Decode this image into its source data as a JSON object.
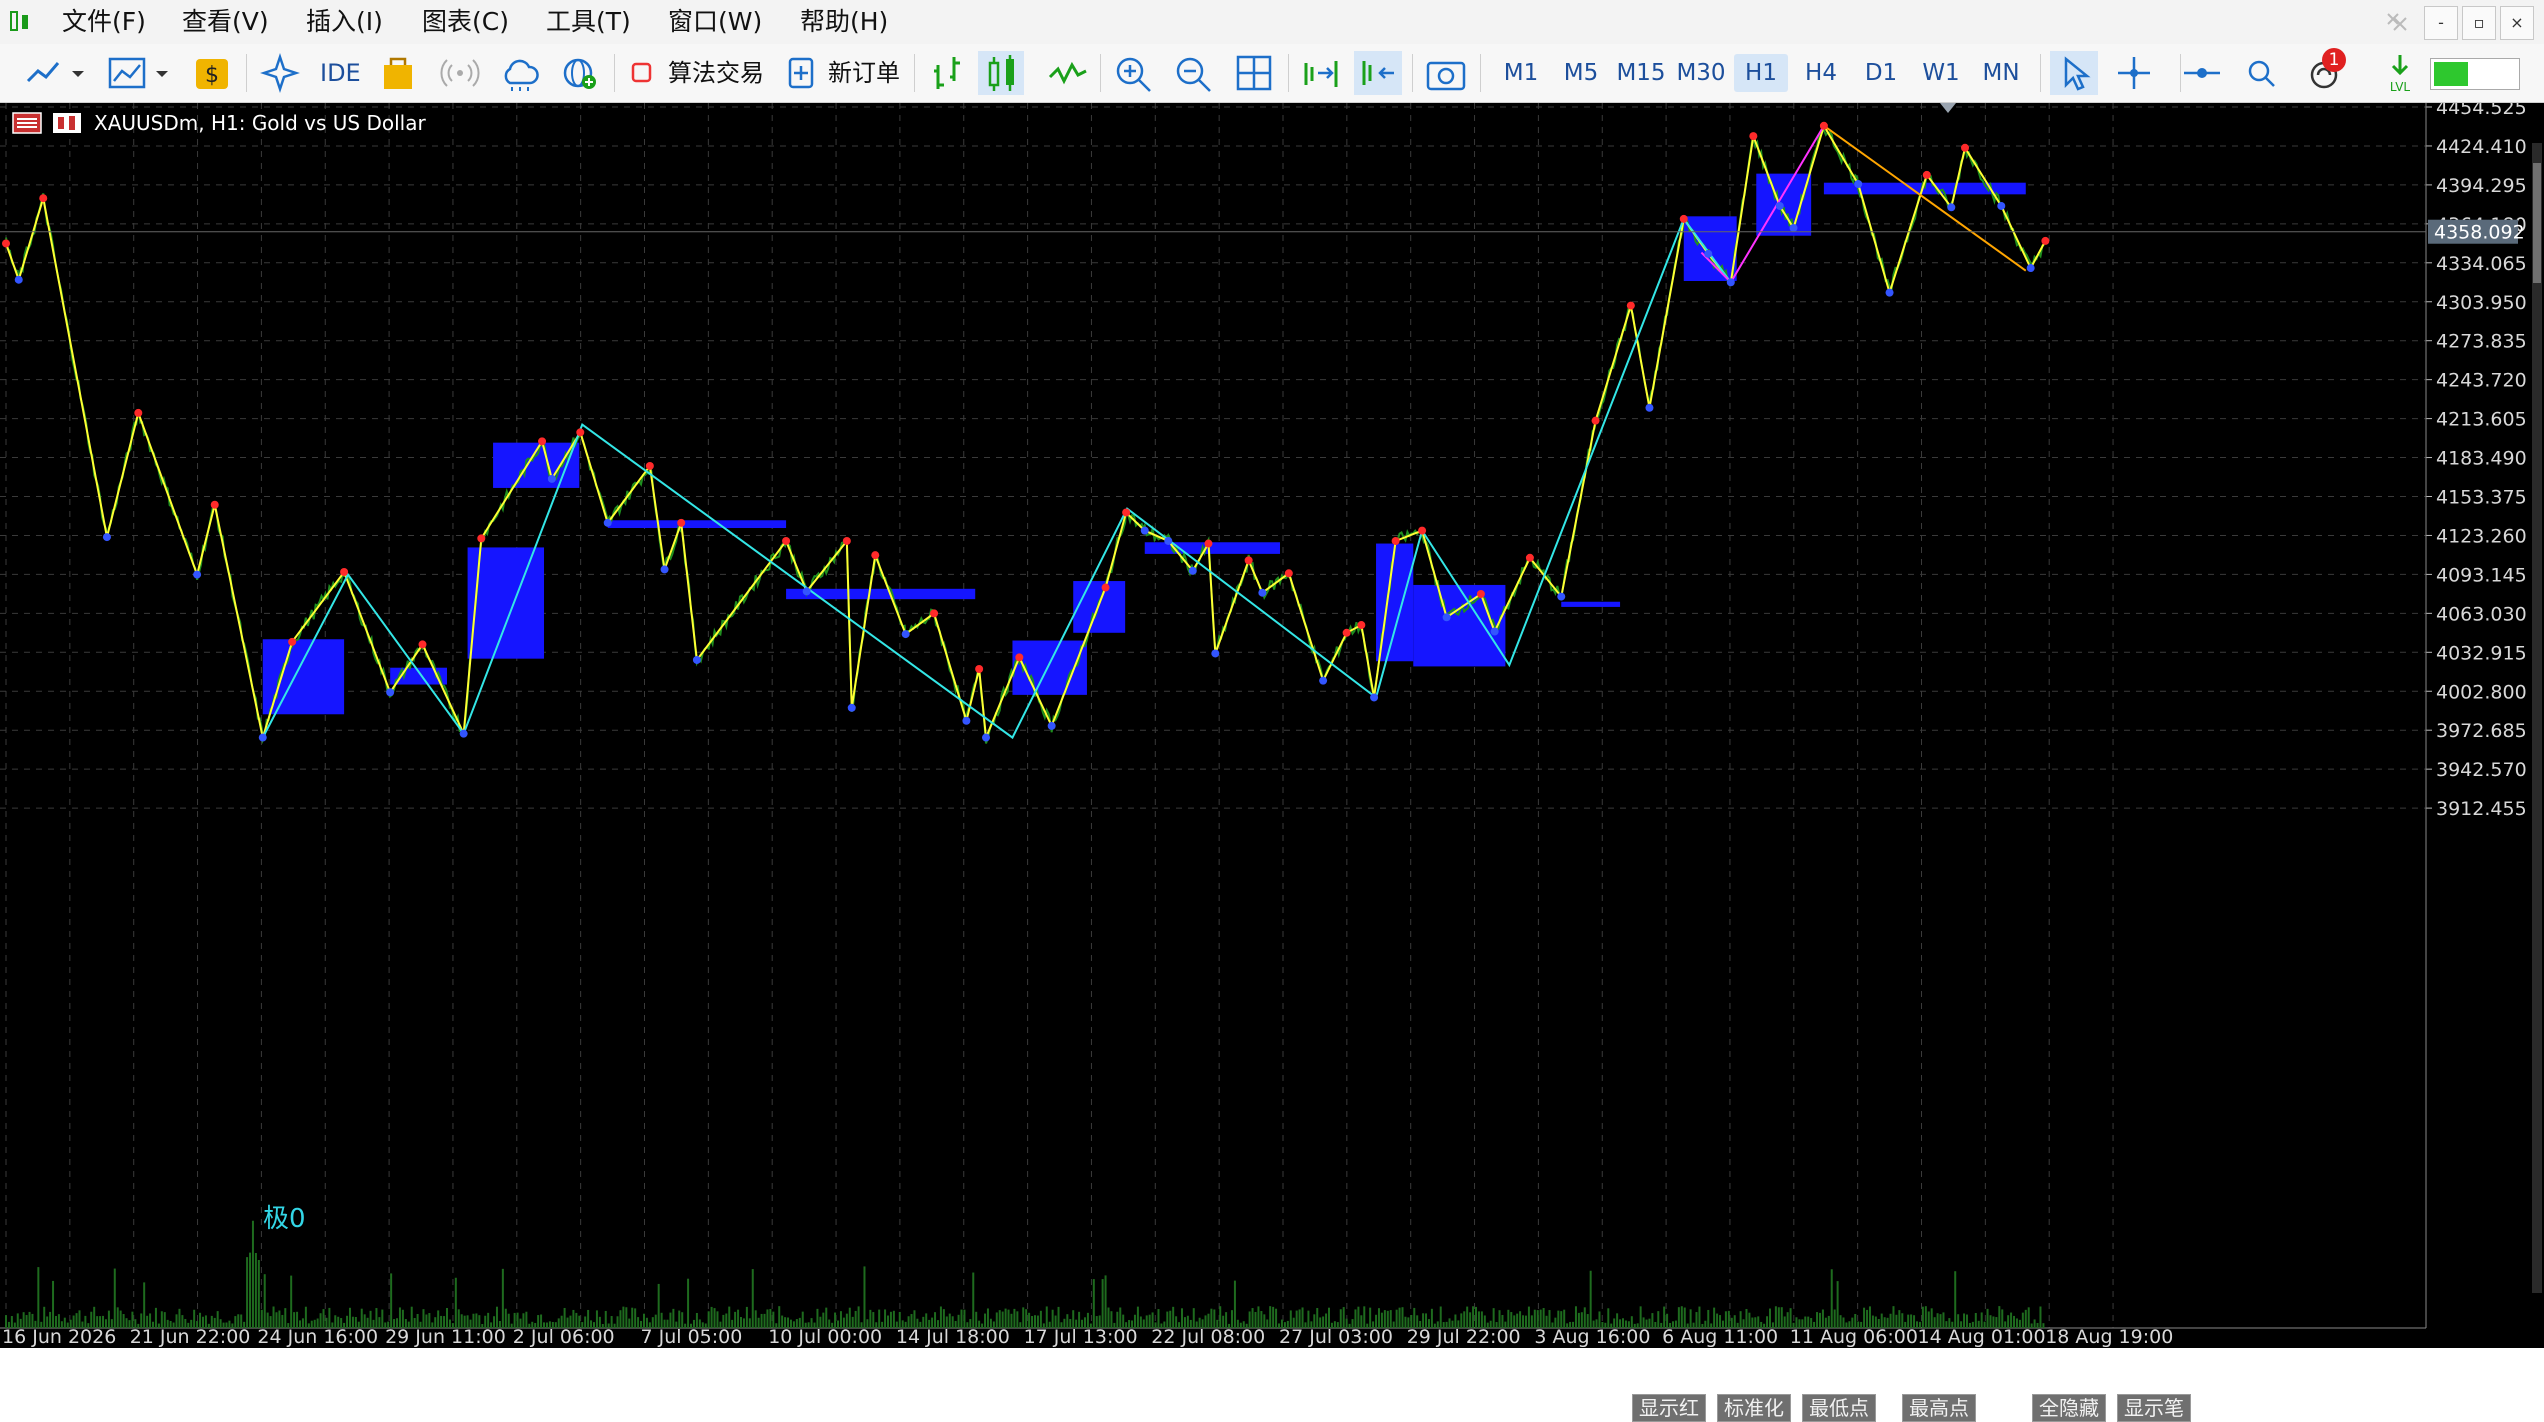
{
  "menu": {
    "items": [
      "文件(F)",
      "查看(V)",
      "插入(I)",
      "图表(C)",
      "工具(T)",
      "窗口(W)",
      "帮助(H)"
    ]
  },
  "window_controls": {
    "minimize": "-",
    "restore": "▫",
    "close": "×"
  },
  "toolbar": {
    "ide_label": "IDE",
    "algo_trading_label": "算法交易",
    "new_order_label": "新订单",
    "timeframes": [
      "M1",
      "M5",
      "M15",
      "M30",
      "H1",
      "H4",
      "D1",
      "W1",
      "MN"
    ],
    "active_timeframe": "H1",
    "notification_count": "1",
    "icons": [
      "line-tool-icon",
      "chart-type-icon",
      "dollar-icon",
      "sparkle-icon",
      "shopping-bag-icon",
      "signal-icon",
      "cloud-icon",
      "globe-add-icon",
      "bar-chart-icon",
      "candlestick-icon",
      "line-chart-icon",
      "zoom-in-icon",
      "zoom-out-icon",
      "grid-icon",
      "autoscroll-icon",
      "chart-shift-icon",
      "screenshot-icon",
      "cursor-icon",
      "crosshair-icon",
      "horizontal-line-icon",
      "search-icon",
      "notifications-icon",
      "lvl-icon",
      "signal-strength-icon"
    ]
  },
  "chart": {
    "header": "XAUUSDm, H1:  Gold vs US Dollar",
    "current_price": "4358.092",
    "pivot_label": "极0",
    "colors": {
      "background": "#000000",
      "grid": "#3a3a3a",
      "price_series": "#1f8f1f",
      "zigzag": "#ffff33",
      "swing_line": "#33e6e6",
      "pink_line": "#ff33ff",
      "orange_line": "#ffa500",
      "zone": "#1515ff",
      "pivot_marker": "#ff2a2a"
    },
    "price_axis": [
      "4454.525",
      "4424.410",
      "4394.295",
      "4364.180",
      "4334.065",
      "4303.950",
      "4273.835",
      "4243.720",
      "4213.605",
      "4183.490",
      "4153.375",
      "4123.260",
      "4093.145",
      "4063.030",
      "4032.915",
      "4002.800",
      "3972.685",
      "3942.570",
      "3912.455"
    ],
    "time_axis": [
      "16 Jun 2026",
      "21 Jun 22:00",
      "24 Jun 16:00",
      "29 Jun 11:00",
      "2 Jul 06:00",
      "7 Jul 05:00",
      "10 Jul 00:00",
      "14 Jul 18:00",
      "17 Jul 13:00",
      "22 Jul 08:00",
      "27 Jul 03:00",
      "29 Jul 22:00",
      "3 Aug 16:00",
      "6 Aug 11:00",
      "11 Aug 06:00",
      "14 Aug 01:00",
      "18 Aug 19:00"
    ],
    "bottom_buttons": [
      "显示红",
      "标准化",
      "最低点",
      "最高点",
      "全隐藏",
      "显示笔"
    ]
  },
  "chart_data": {
    "type": "line",
    "symbol": "XAUUSDm",
    "timeframe": "H1",
    "title": "Gold vs US Dollar",
    "ylim": [
      3897,
      4462
    ],
    "x": [
      "16 Jun 2026",
      "21 Jun 22:00",
      "24 Jun 16:00",
      "29 Jun 11:00",
      "2 Jul 06:00",
      "7 Jul 05:00",
      "10 Jul 00:00",
      "14 Jul 18:00",
      "17 Jul 13:00",
      "22 Jul 08:00",
      "27 Jul 03:00",
      "29 Jul 22:00",
      "3 Aug 16:00",
      "6 Aug 11:00",
      "11 Aug 06:00",
      "14 Aug 01:00",
      "18 Aug 19:00"
    ],
    "series": [
      {
        "type": "zigzag",
        "points": [
          [
            0,
            4349
          ],
          [
            13,
            4321
          ],
          [
            38,
            4384
          ],
          [
            103,
            4122
          ],
          [
            135,
            4218
          ],
          [
            195,
            4093
          ],
          [
            213,
            4147
          ],
          [
            262,
            3967
          ],
          [
            292,
            4041
          ],
          [
            345,
            4095
          ],
          [
            392,
            4002
          ],
          [
            425,
            4039
          ],
          [
            467,
            3970
          ],
          [
            485,
            4121
          ],
          [
            547,
            4196
          ],
          [
            557,
            4167
          ],
          [
            586,
            4203
          ],
          [
            614,
            4133
          ],
          [
            657,
            4177
          ],
          [
            672,
            4097
          ],
          [
            689,
            4133
          ],
          [
            705,
            4027
          ],
          [
            796,
            4119
          ],
          [
            817,
            4080
          ],
          [
            858,
            4119
          ],
          [
            863,
            3990
          ],
          [
            887,
            4108
          ],
          [
            918,
            4047
          ],
          [
            947,
            4063
          ],
          [
            980,
            3980
          ],
          [
            993,
            4020
          ],
          [
            1000,
            3967
          ],
          [
            1034,
            4029
          ],
          [
            1067,
            3976
          ],
          [
            1122,
            4083
          ],
          [
            1143,
            4141
          ],
          [
            1162,
            4127
          ],
          [
            1186,
            4119
          ],
          [
            1211,
            4096
          ],
          [
            1227,
            4117
          ],
          [
            1234,
            4032
          ],
          [
            1268,
            4104
          ],
          [
            1282,
            4079
          ],
          [
            1309,
            4094
          ],
          [
            1344,
            4011
          ],
          [
            1368,
            4048
          ],
          [
            1383,
            4054
          ],
          [
            1396,
            3998
          ],
          [
            1418,
            4119
          ],
          [
            1445,
            4127
          ],
          [
            1470,
            4060
          ],
          [
            1505,
            4078
          ],
          [
            1519,
            4049
          ],
          [
            1555,
            4106
          ],
          [
            1587,
            4076
          ],
          [
            1622,
            4212
          ],
          [
            1658,
            4301
          ],
          [
            1677,
            4222
          ],
          [
            1712,
            4368
          ],
          [
            1737,
            4341
          ],
          [
            1760,
            4319
          ],
          [
            1783,
            4432
          ],
          [
            1810,
            4378
          ],
          [
            1824,
            4361
          ],
          [
            1855,
            4440
          ],
          [
            1890,
            4395
          ],
          [
            1922,
            4311
          ],
          [
            1960,
            4402
          ],
          [
            1985,
            4377
          ],
          [
            1999,
            4423
          ],
          [
            2036,
            4378
          ],
          [
            2066,
            4330
          ],
          [
            2081,
            4351
          ]
        ]
      },
      {
        "type": "swing",
        "points": [
          [
            262,
            3967
          ],
          [
            349,
            4093
          ],
          [
            467,
            3970
          ],
          [
            588,
            4209
          ],
          [
            1027,
            3967
          ],
          [
            1144,
            4144
          ],
          [
            1398,
            3998
          ],
          [
            1445,
            4127
          ],
          [
            1534,
            4023
          ],
          [
            1712,
            4368
          ],
          [
            1760,
            4319
          ]
        ]
      },
      {
        "type": "overlay",
        "points": [
          [
            1730,
            4342
          ],
          [
            1760,
            4319
          ],
          [
            1855,
            4440
          ],
          [
            2061,
            4328
          ]
        ]
      }
    ],
    "zones": [
      {
        "from": "24 Jun",
        "top": 4043,
        "bottom": 3985
      },
      {
        "from": "27 Jun",
        "top": 4021,
        "bottom": 4008
      },
      {
        "from": "2 Jul",
        "top": 4114,
        "bottom": 4028
      },
      {
        "from": "4 Jul",
        "top": 4195,
        "bottom": 4160
      },
      {
        "from": "7 Jul",
        "top": 4135,
        "bottom": 4129
      },
      {
        "from": "10 Jul",
        "top": 4082,
        "bottom": 4074
      },
      {
        "from": "17 Jul",
        "top": 4042,
        "bottom": 4000
      },
      {
        "from": "19 Jul",
        "top": 4088,
        "bottom": 4048
      },
      {
        "from": "22 Jul",
        "top": 4118,
        "bottom": 4109
      },
      {
        "from": "29 Jul",
        "top": 4117,
        "bottom": 4026
      },
      {
        "from": "30 Jul",
        "top": 4085,
        "bottom": 4022
      },
      {
        "from": "2 Aug",
        "top": 4072,
        "bottom": 4068
      },
      {
        "from": "6 Aug",
        "top": 4370,
        "bottom": 4320
      },
      {
        "from": "8 Aug",
        "top": 4403,
        "bottom": 4355
      },
      {
        "from": "12 Aug",
        "top": 4396,
        "bottom": 4387
      }
    ]
  }
}
